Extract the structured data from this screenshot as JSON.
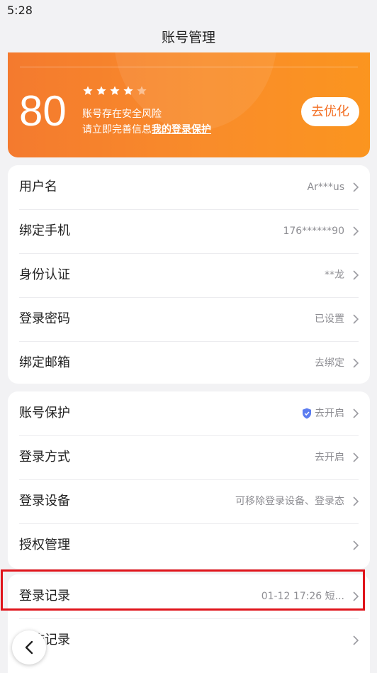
{
  "status": {
    "time": "5:28"
  },
  "header": {
    "title": "账号管理"
  },
  "score": {
    "value": "80",
    "rating": 4,
    "rating_max": 5,
    "risk_text": "账号存在安全风险",
    "tip_text": "请立即完善信息",
    "tip_link": "我的登录保护",
    "optimize_label": "去优化"
  },
  "account_info": [
    {
      "label": "用户名",
      "value": "Ar***us"
    },
    {
      "label": "绑定手机",
      "value": "176******90"
    },
    {
      "label": "身份认证",
      "value": "**龙"
    },
    {
      "label": "登录密码",
      "value": "已设置"
    },
    {
      "label": "绑定邮箱",
      "value": "去绑定"
    }
  ],
  "security": [
    {
      "label": "账号保护",
      "value": "去开启",
      "icon": "shield-check-icon"
    },
    {
      "label": "登录方式",
      "value": "去开启"
    },
    {
      "label": "登录设备",
      "value": "可移除登录设备、登录态"
    },
    {
      "label": "授权管理",
      "value": ""
    }
  ],
  "records": [
    {
      "label": "登录记录",
      "value": "01-12 17:26 短..."
    },
    {
      "label": "操作记录",
      "value": ""
    }
  ],
  "colors": {
    "accent": "#f36f24",
    "highlight": "#e0141b",
    "shield": "#5b7cf0"
  }
}
